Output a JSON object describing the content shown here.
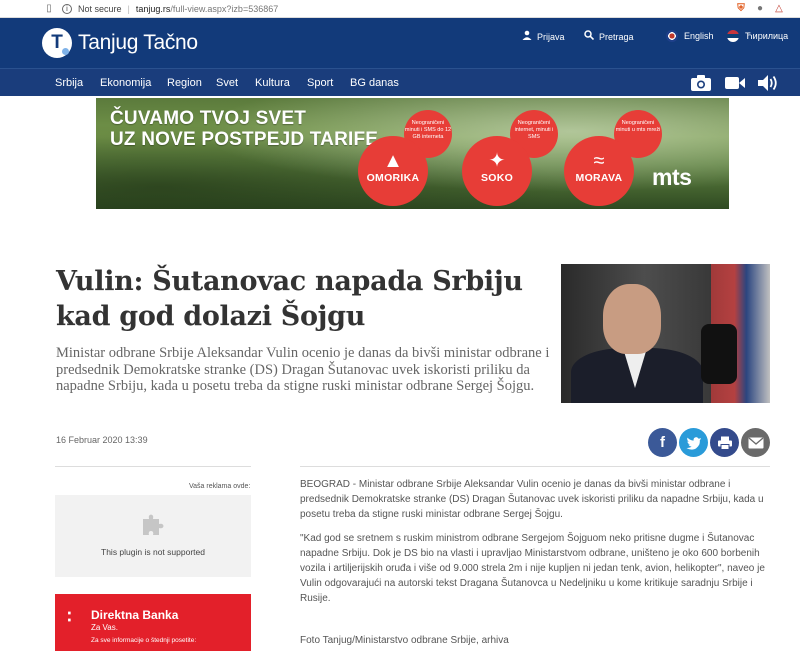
{
  "browser": {
    "security": "Not secure",
    "url_host": "tanjug.rs",
    "url_path": "/full-view.aspx?izb=536867",
    "separator": "|"
  },
  "header": {
    "logo_letter": "T",
    "logo_text": "Tanjug Tačno",
    "login": "Prijava",
    "search": "Pretraga",
    "english": "English",
    "cyrillic": "Ћирилица"
  },
  "nav": {
    "items": [
      "Srbija",
      "Ekonomija",
      "Region",
      "Svet",
      "Kultura",
      "Sport",
      "BG danas"
    ]
  },
  "banner": {
    "headline_1": "ČUVAMO TVOJ SVET",
    "headline_2": "UZ NOVE POSTPEJD TARIFE",
    "tag_1": "Neograničeni minuti i SMS do 12 GB interneta",
    "tag_2": "Neograničeni internet, minuti i SMS",
    "tag_3": "Neograničeni minuti u mts mreži",
    "plan_1": "OMORIKA",
    "plan_2": "SOKO",
    "plan_3": "MORAVA",
    "brand": "mts"
  },
  "article": {
    "title": "Vulin: Šutanovac napada Srbiju kad god dolazi Šojgu",
    "lead": "Ministar odbrane Srbije Aleksandar Vulin ocenio je danas da bivši ministar odbrane i predsednik Demokratske stranke (DS) Dragan Šutanovac uvek iskoristi priliku da napadne Srbiju, kada u posetu treba da stigne ruski ministar odbrane Sergej Šojgu.",
    "date": "16 Februar 2020 13:39",
    "paragraph_1": "BEOGRAD - Ministar odbrane Srbije Aleksandar Vulin ocenio je danas da bivši ministar odbrane i predsednik Demokratske stranke (DS) Dragan Šutanovac uvek iskoristi priliku da napadne Srbiju, kada u posetu treba da stigne ruski ministar odbrane Sergej Šojgu.",
    "paragraph_2": "\"Kad god se sretnem s ruskim ministrom odbrane Sergejom Šojguom neko pritisne dugme i Šutanovac napadne Srbiju. Dok je DS bio na vlasti i upravljao Ministarstvom odbrane, uništeno je oko 600 borbenih vozila i artiljerijskih oruđa i više od 9.000 strela 2m i nije kupljen ni jedan tenk, avion, helikopter\", naveo je Vulin odgovarajući na autorski tekst Dragana Šutanovca u Nedeljniku u kome kritikuje saradnju Srbije i Rusije.",
    "photo_credit": "Foto Tanjug/Ministarstvo odbrane Srbije, arhiva"
  },
  "sidebar": {
    "ad_label": "Vaša reklama ovde:",
    "plugin_message": "This plugin is not supported",
    "bank_name": "Direktna Banka",
    "bank_slogan": "Za Vas.",
    "bank_info": "Za sve informacije o štednji posetite:"
  },
  "colors": {
    "header_bg": "#123a7a",
    "nav_bg": "#1a3d7c",
    "ad_red": "#e73d37",
    "bank_red": "#e3202a",
    "facebook": "#3b5998",
    "twitter": "#2a9bd9"
  }
}
